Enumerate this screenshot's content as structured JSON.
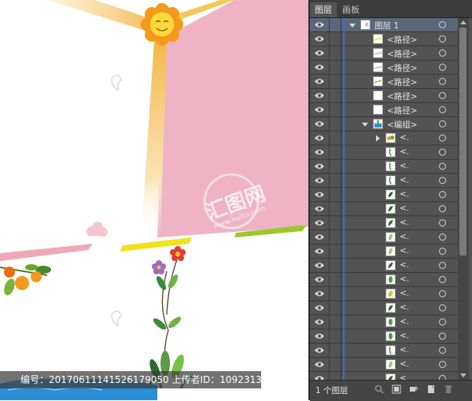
{
  "panel": {
    "tabs": [
      {
        "label": "图层",
        "active": true
      },
      {
        "label": "画板",
        "active": false
      }
    ],
    "layers": [
      {
        "name": "图层 1",
        "level": 0,
        "expanded": true,
        "thumb": "layer",
        "selected": true
      },
      {
        "name": "<路径>",
        "level": 1,
        "thumb": "yellow-line"
      },
      {
        "name": "<路径>",
        "level": 1,
        "thumb": "pink-line"
      },
      {
        "name": "<路径>",
        "level": 1,
        "thumb": "pink-line"
      },
      {
        "name": "<路径>",
        "level": 1,
        "thumb": "green-line"
      },
      {
        "name": "<路径>",
        "level": 1,
        "thumb": "blank"
      },
      {
        "name": "<路径>",
        "level": 1,
        "thumb": "blank"
      },
      {
        "name": "<编组>",
        "level": 1,
        "expanded": true,
        "thumb": "group"
      },
      {
        "name": "<.",
        "level": 2,
        "collapsed": true,
        "thumb": "fruit"
      },
      {
        "name": "<.",
        "level": 2,
        "thumb": "stem"
      },
      {
        "name": "<.",
        "level": 2,
        "thumb": "stem"
      },
      {
        "name": "<.",
        "level": 2,
        "thumb": "stem"
      },
      {
        "name": "<.",
        "level": 2,
        "thumb": "leaf-dark"
      },
      {
        "name": "<.",
        "level": 2,
        "thumb": "leaf-dark"
      },
      {
        "name": "<.",
        "level": 2,
        "thumb": "leaf-dark"
      },
      {
        "name": "<.",
        "level": 2,
        "thumb": "leaf-light"
      },
      {
        "name": "<.",
        "level": 2,
        "thumb": "leaf-light"
      },
      {
        "name": "<.",
        "level": 2,
        "thumb": "leaf-dark"
      },
      {
        "name": "<.",
        "level": 2,
        "thumb": "leaf-mid"
      },
      {
        "name": "<.",
        "level": 2,
        "thumb": "leaf-yellow"
      },
      {
        "name": "<.",
        "level": 2,
        "thumb": "leaf-dark"
      },
      {
        "name": "<.",
        "level": 2,
        "thumb": "leaf-mid"
      },
      {
        "name": "<.",
        "level": 2,
        "thumb": "leaf-mid"
      },
      {
        "name": "<.",
        "level": 2,
        "thumb": "stem"
      },
      {
        "name": "<.",
        "level": 2,
        "thumb": "leaf-light"
      },
      {
        "name": "<.",
        "level": 2,
        "thumb": "leaf-dark"
      },
      {
        "name": "<.",
        "level": 2,
        "thumb": "leaf-mid"
      },
      {
        "name": "<.",
        "level": 2,
        "thumb": "red-blob"
      }
    ],
    "layer_count": "1 个图层"
  },
  "watermark": {
    "text": "编号：20170611141526179050 上传者ID：1092313",
    "logo_text": "汇图网",
    "logo_sub": "www.huitu.com"
  },
  "colors": {
    "pink_panel": "#efb3c5",
    "sun_orange": "#f39a1c",
    "sun_face": "#ffd93a",
    "ray_yellow": "#f7c64d",
    "panel_bg": "#535353",
    "selection": "#5b6779",
    "layer_color": "#2f6fe0"
  }
}
